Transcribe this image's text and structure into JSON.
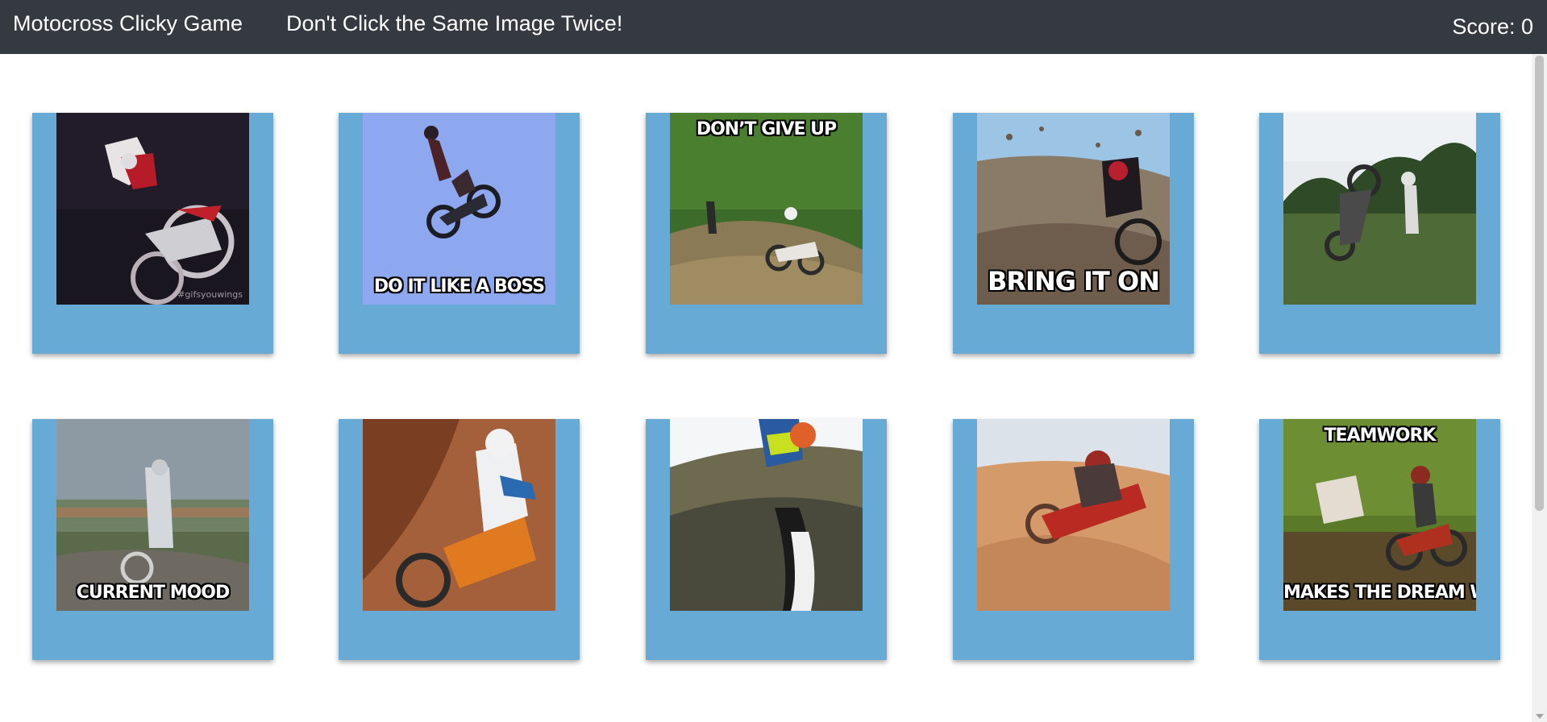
{
  "navbar": {
    "brand": "Motocross Clicky Game",
    "instructions": "Don't Click the Same Image Twice!",
    "score_label": "Score: ",
    "score_value": "0"
  },
  "cards": [
    {
      "name": "card-freestyle-night",
      "caption_top": "",
      "caption_bottom": "",
      "watermark": "#gifsyouwings",
      "icon": "motocross-freestyle-image"
    },
    {
      "name": "card-boss-jump",
      "caption_top": "",
      "caption_bottom": "DO IT LIKE A BOSS",
      "icon": "motocross-jump-image"
    },
    {
      "name": "card-dont-give-up",
      "caption_top": "DON’T GIVE UP",
      "caption_bottom": "",
      "icon": "motocross-hill-image"
    },
    {
      "name": "card-bring-it-on",
      "caption_top": "",
      "caption_bottom": "BRING IT ON",
      "icon": "motocross-roost-image"
    },
    {
      "name": "card-field-crash",
      "caption_top": "",
      "caption_bottom": "",
      "icon": "motocross-crash-image"
    },
    {
      "name": "card-current-mood",
      "caption_top": "",
      "caption_bottom": "CURRENT MOOD",
      "icon": "motocross-mud-image"
    },
    {
      "name": "card-sand-rider",
      "caption_top": "",
      "caption_bottom": "",
      "icon": "motocross-sand-image"
    },
    {
      "name": "card-flip-fail",
      "caption_top": "",
      "caption_bottom": "",
      "icon": "motocross-flip-image"
    },
    {
      "name": "card-dune-crash",
      "caption_top": "",
      "caption_bottom": "",
      "icon": "motocross-dune-image"
    },
    {
      "name": "card-teamwork",
      "caption_top": "TEAMWORK",
      "caption_bottom": "MAKES THE DREAM WORK",
      "icon": "motocross-teamwork-image"
    }
  ],
  "colors": {
    "navbar": "#343a40",
    "card": "#67aad6"
  }
}
